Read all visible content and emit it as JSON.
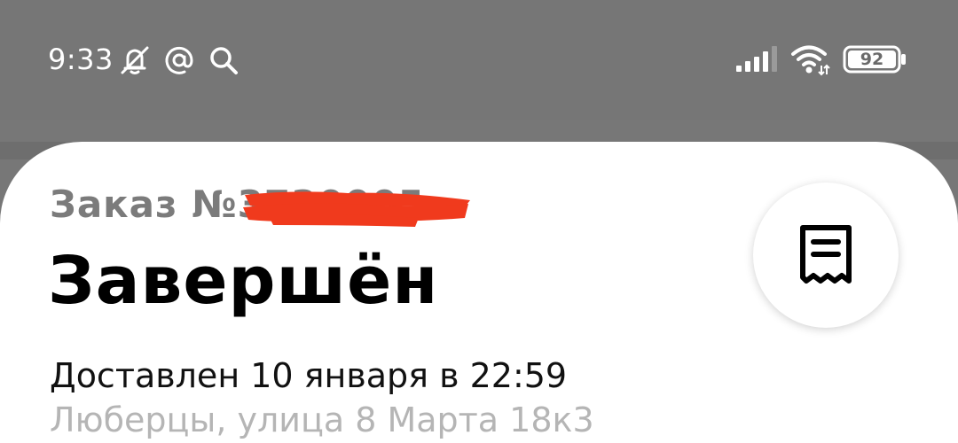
{
  "status_bar": {
    "time": "9:33",
    "left_icons": [
      "bell-off-icon",
      "at-sign-icon",
      "search-icon"
    ],
    "right_icons": [
      "signal-icon",
      "wifi-icon",
      "battery-icon"
    ],
    "battery_level": "92"
  },
  "order": {
    "number_prefix": "Заказ №3",
    "number_tail": "730005",
    "status": "Завершён",
    "delivered": "Доставлен 10 января в 22:59",
    "address": "Люберцы, улица 8 Марта 18к3"
  },
  "colors": {
    "statusbar_bg": "#767676",
    "sheet_bg": "#ffffff",
    "redaction": "#f03a1d"
  },
  "receipt_button": {
    "icon": "receipt-icon"
  }
}
